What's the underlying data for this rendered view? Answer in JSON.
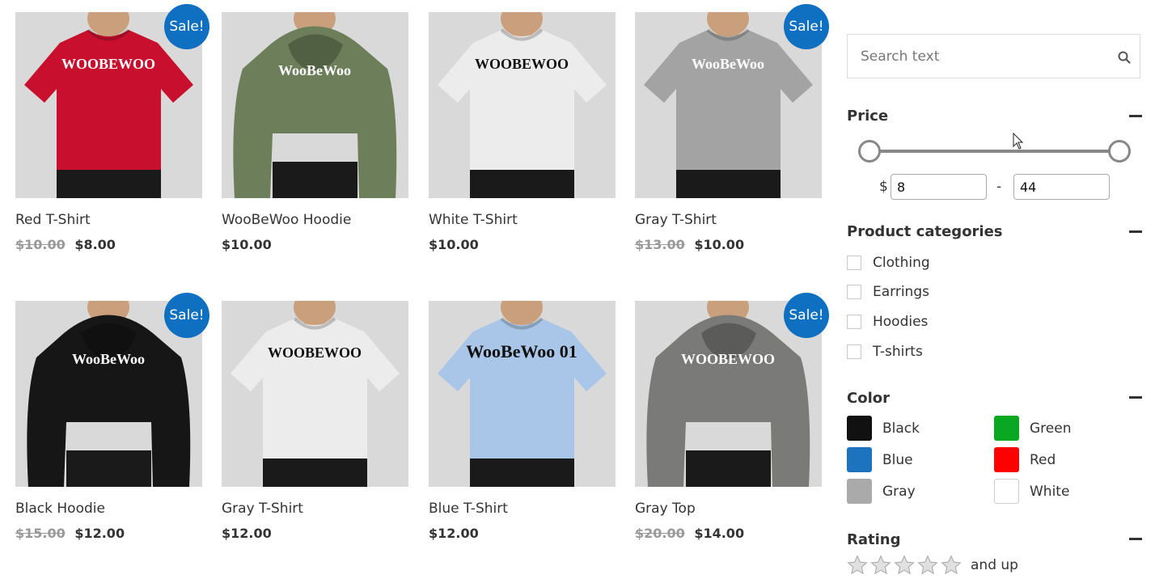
{
  "products": [
    {
      "title": "Red T-Shirt",
      "old_price": "$10.00",
      "price": "$8.00",
      "sale": "Sale!",
      "garment": "tshirt",
      "color": "#c8102e",
      "print": "WOOBEWOO"
    },
    {
      "title": "WooBeWoo Hoodie",
      "old_price": "",
      "price": "$10.00",
      "sale": "",
      "garment": "hoodie",
      "color": "#6d7f5a",
      "print": "WooBeWoo"
    },
    {
      "title": "White T-Shirt",
      "old_price": "",
      "price": "$10.00",
      "sale": "",
      "garment": "tshirt",
      "color": "#ececec",
      "print": "WOOBEWOO"
    },
    {
      "title": "Gray T-Shirt",
      "old_price": "$13.00",
      "price": "$10.00",
      "sale": "Sale!",
      "garment": "tshirt",
      "color": "#a3a3a3",
      "print": "WooBeWoo"
    },
    {
      "title": "Black Hoodie",
      "old_price": "$15.00",
      "price": "$12.00",
      "sale": "Sale!",
      "garment": "hoodie",
      "color": "#161616",
      "print": "WooBeWoo"
    },
    {
      "title": "Gray T-Shirt",
      "old_price": "",
      "price": "$12.00",
      "sale": "",
      "garment": "tshirt",
      "color": "#ececec",
      "print": "WOOBEWOO"
    },
    {
      "title": "Blue T-Shirt",
      "old_price": "",
      "price": "$12.00",
      "sale": "",
      "garment": "tshirt",
      "color": "#a9c6e8",
      "print": "WooBeWoo 01"
    },
    {
      "title": "Gray Top",
      "old_price": "$20.00",
      "price": "$14.00",
      "sale": "Sale!",
      "garment": "hoodie",
      "color": "#7a7a78",
      "print": "WOOBEWOO"
    }
  ],
  "sidebar": {
    "search": {
      "placeholder": "Search text",
      "icon": "search-icon"
    },
    "price": {
      "heading": "Price",
      "currency": "$",
      "min": "8",
      "max": "44",
      "separator": "-"
    },
    "categories": {
      "heading": "Product categories",
      "items": [
        "Clothing",
        "Earrings",
        "Hoodies",
        "T-shirts"
      ]
    },
    "color": {
      "heading": "Color",
      "items": [
        {
          "label": "Black",
          "hex": "#111111"
        },
        {
          "label": "Green",
          "hex": "#0aa822"
        },
        {
          "label": "Blue",
          "hex": "#1e73be"
        },
        {
          "label": "Red",
          "hex": "#ff0000"
        },
        {
          "label": "Gray",
          "hex": "#aaaaaa"
        },
        {
          "label": "White",
          "hex": "#ffffff"
        }
      ]
    },
    "rating": {
      "heading": "Rating",
      "and_up": "and up",
      "stars": 5
    }
  }
}
